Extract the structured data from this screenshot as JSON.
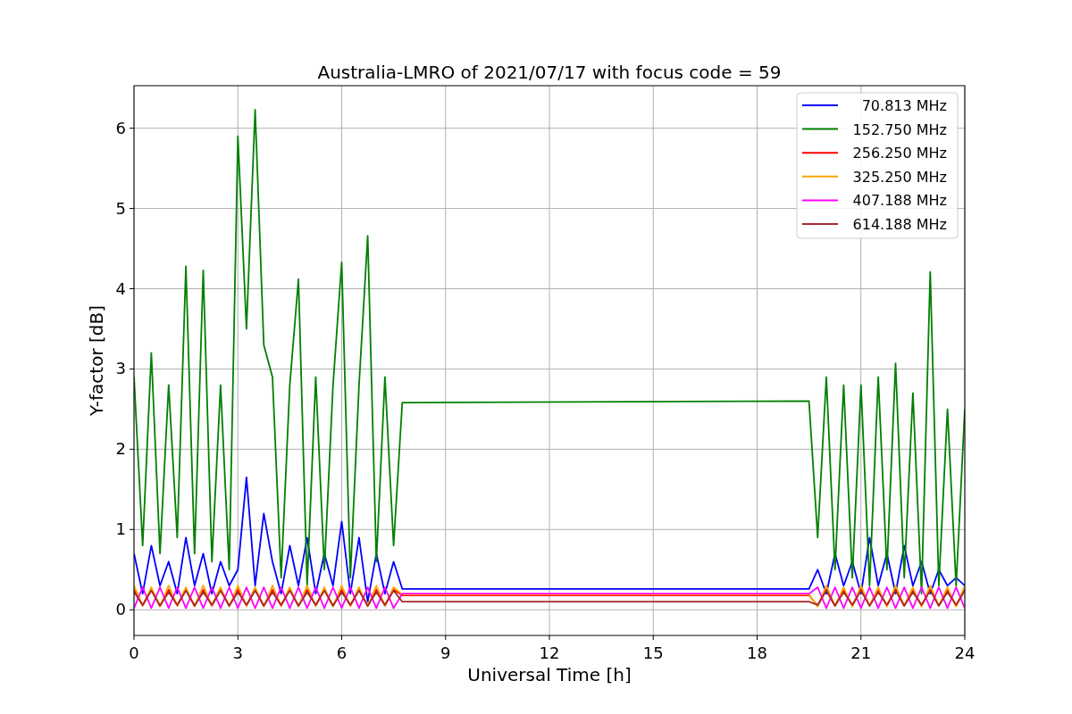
{
  "figure": {
    "chart_data": {
      "type": "line",
      "title": "Australia-LMRO of 2021/07/17 with focus code = 59",
      "xlabel": "Universal Time [h]",
      "ylabel": "Y-factor [dB]",
      "x": [
        0,
        0.25,
        0.5,
        0.75,
        1,
        1.25,
        1.5,
        1.75,
        2,
        2.25,
        2.5,
        2.75,
        3,
        3.25,
        3.5,
        3.75,
        4,
        4.25,
        4.5,
        4.75,
        5,
        5.25,
        5.5,
        5.75,
        6,
        6.25,
        6.5,
        6.75,
        7,
        7.25,
        7.5,
        7.75,
        19.5,
        19.75,
        20,
        20.25,
        20.5,
        20.75,
        21,
        21.25,
        21.5,
        21.75,
        22,
        22.25,
        22.5,
        22.75,
        23,
        23.25,
        23.5,
        23.75,
        24
      ],
      "series": [
        {
          "name": "70.813 MHz",
          "color": "#0000ff",
          "values": [
            0.7,
            0.2,
            0.8,
            0.3,
            0.6,
            0.2,
            0.9,
            0.3,
            0.7,
            0.2,
            0.6,
            0.3,
            0.5,
            1.65,
            0.3,
            1.2,
            0.6,
            0.2,
            0.8,
            0.3,
            0.9,
            0.2,
            0.7,
            0.3,
            1.1,
            0.2,
            0.9,
            0.1,
            0.7,
            0.2,
            0.6,
            0.26,
            0.26,
            0.5,
            0.2,
            0.7,
            0.3,
            0.6,
            0.2,
            0.9,
            0.3,
            0.7,
            0.2,
            0.8,
            0.3,
            0.6,
            0.2,
            0.5,
            0.3,
            0.4,
            0.3
          ]
        },
        {
          "name": "152.750 MHz",
          "color": "#008000",
          "values": [
            2.9,
            0.8,
            3.2,
            0.7,
            2.8,
            0.9,
            4.28,
            0.7,
            4.23,
            0.6,
            2.8,
            0.5,
            5.9,
            3.5,
            6.23,
            3.3,
            2.9,
            0.4,
            2.8,
            4.12,
            0.3,
            2.9,
            0.5,
            2.8,
            4.33,
            0.4,
            2.8,
            4.66,
            0.6,
            2.9,
            0.8,
            2.58,
            2.6,
            0.9,
            2.9,
            0.5,
            2.8,
            0.4,
            2.8,
            0.3,
            2.9,
            0.5,
            3.07,
            0.4,
            2.7,
            0.2,
            4.21,
            0.3,
            2.5,
            0.3,
            2.5
          ]
        },
        {
          "name": "256.250 MHz",
          "color": "#ff0000",
          "values": [
            0.25,
            0.05,
            0.25,
            0.05,
            0.25,
            0.05,
            0.25,
            0.05,
            0.25,
            0.05,
            0.25,
            0.05,
            0.25,
            0.05,
            0.25,
            0.05,
            0.25,
            0.05,
            0.25,
            0.05,
            0.25,
            0.05,
            0.25,
            0.05,
            0.25,
            0.05,
            0.25,
            0.05,
            0.25,
            0.05,
            0.25,
            0.18,
            0.18,
            0.05,
            0.25,
            0.05,
            0.25,
            0.05,
            0.25,
            0.05,
            0.25,
            0.05,
            0.25,
            0.05,
            0.25,
            0.05,
            0.25,
            0.05,
            0.25,
            0.05,
            0.25
          ]
        },
        {
          "name": "325.250 MHz",
          "color": "#ffa500",
          "values": [
            0.3,
            0.05,
            0.28,
            0.04,
            0.3,
            0.05,
            0.28,
            0.04,
            0.3,
            0.05,
            0.28,
            0.04,
            0.3,
            0.05,
            0.28,
            0.04,
            0.3,
            0.05,
            0.28,
            0.04,
            0.3,
            0.05,
            0.28,
            0.04,
            0.3,
            0.05,
            0.28,
            0.04,
            0.3,
            0.05,
            0.28,
            0.19,
            0.19,
            0.04,
            0.3,
            0.05,
            0.28,
            0.04,
            0.3,
            0.05,
            0.28,
            0.04,
            0.3,
            0.05,
            0.28,
            0.04,
            0.3,
            0.05,
            0.28,
            0.04,
            0.3
          ]
        },
        {
          "name": "407.188 MHz",
          "color": "#ff00ff",
          "values": [
            0.02,
            0.28,
            0.02,
            0.28,
            0.02,
            0.28,
            0.02,
            0.28,
            0.02,
            0.28,
            0.02,
            0.28,
            0.02,
            0.28,
            0.02,
            0.28,
            0.02,
            0.28,
            0.02,
            0.28,
            0.02,
            0.28,
            0.02,
            0.28,
            0.02,
            0.28,
            0.02,
            0.28,
            0.02,
            0.28,
            0.02,
            0.2,
            0.2,
            0.28,
            0.02,
            0.28,
            0.02,
            0.28,
            0.02,
            0.28,
            0.02,
            0.28,
            0.02,
            0.28,
            0.02,
            0.28,
            0.02,
            0.28,
            0.02,
            0.28,
            0.02
          ]
        },
        {
          "name": "614.188 MHz",
          "color": "#a52a2a",
          "values": [
            0.22,
            0.06,
            0.24,
            0.05,
            0.22,
            0.06,
            0.24,
            0.05,
            0.22,
            0.06,
            0.24,
            0.05,
            0.22,
            0.06,
            0.24,
            0.05,
            0.22,
            0.06,
            0.24,
            0.05,
            0.22,
            0.06,
            0.24,
            0.05,
            0.22,
            0.06,
            0.24,
            0.05,
            0.22,
            0.06,
            0.24,
            0.1,
            0.1,
            0.06,
            0.24,
            0.05,
            0.22,
            0.06,
            0.24,
            0.05,
            0.22,
            0.06,
            0.24,
            0.05,
            0.22,
            0.06,
            0.24,
            0.05,
            0.22,
            0.06,
            0.24
          ]
        }
      ],
      "grid": true,
      "legend": true,
      "xlim": [
        0,
        24
      ],
      "ylim": [
        -0.32,
        6.53
      ],
      "xticks": [
        0,
        3,
        6,
        9,
        12,
        15,
        18,
        21,
        24
      ],
      "yticks": [
        0,
        1,
        2,
        3,
        4,
        5,
        6
      ]
    }
  }
}
